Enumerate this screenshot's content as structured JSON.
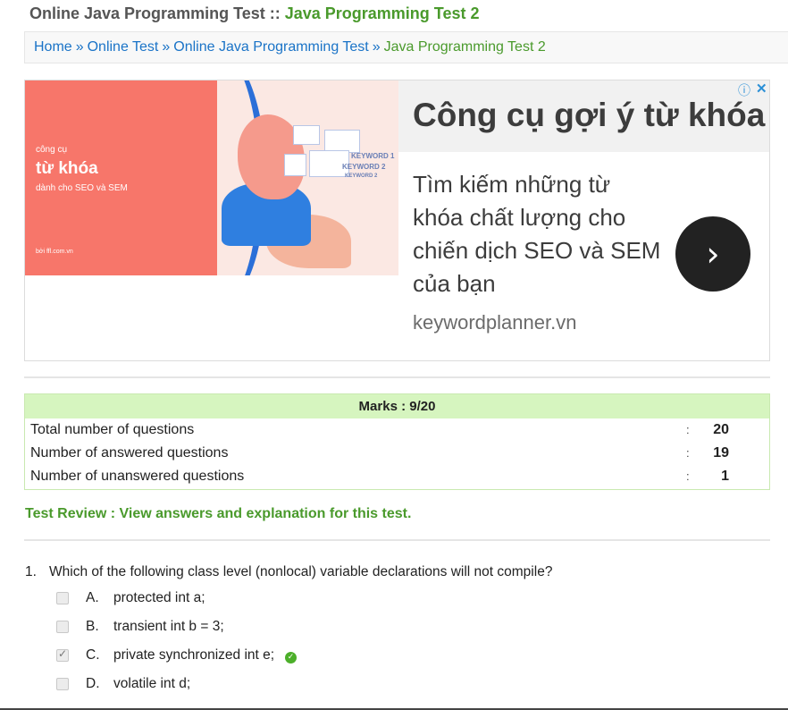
{
  "header": {
    "title_prefix": "Online Java Programming Test :: ",
    "title_highlight": "Java Programming Test 2"
  },
  "breadcrumb": {
    "items": [
      "Home",
      "Online Test",
      "Online Java Programming Test"
    ],
    "separator": "»",
    "current": "Java Programming Test 2"
  },
  "ad": {
    "image_line1": "công cụ",
    "image_line2": "từ khóa",
    "image_line3": "dành cho SEO và SEM",
    "image_brand": "bởi ffl.com.vn",
    "image_keywords": [
      "KEYWORD 1",
      "KEYWORD 2",
      "KEYWORD 2"
    ],
    "title": "Công cụ gợi ý từ khóa",
    "description": "Tìm kiếm những từ khóa chất lượng cho chiến dịch SEO và SEM của bạn",
    "url": "keywordplanner.vn",
    "info_icon": "info-icon",
    "close_icon": "close-icon",
    "arrow_icon": "chevron-right-icon"
  },
  "marks": {
    "header": "Marks : 9/20",
    "rows": [
      {
        "label": "Total number of questions",
        "colon": ":",
        "value": "20"
      },
      {
        "label": "Number of answered questions",
        "colon": ":",
        "value": "19"
      },
      {
        "label": "Number of unanswered questions",
        "colon": ":",
        "value": "1"
      }
    ]
  },
  "review": {
    "text": "Test Review : View answers and explanation for this test."
  },
  "question": {
    "number": "1.",
    "text": "Which of the following class level (nonlocal) variable declarations will not compile?",
    "options": [
      {
        "letter": "A.",
        "text": "protected int a;",
        "checked": false,
        "correct": false
      },
      {
        "letter": "B.",
        "text": "transient int b = 3;",
        "checked": false,
        "correct": false
      },
      {
        "letter": "C.",
        "text": "private synchronized int e;",
        "checked": true,
        "correct": true
      },
      {
        "letter": "D.",
        "text": "volatile int d;",
        "checked": false,
        "correct": false
      }
    ]
  },
  "colors": {
    "link": "#1a73c7",
    "green": "#4a9a2c",
    "marks_header_bg": "#d6f5bf",
    "ad_red": "#f7766a"
  }
}
